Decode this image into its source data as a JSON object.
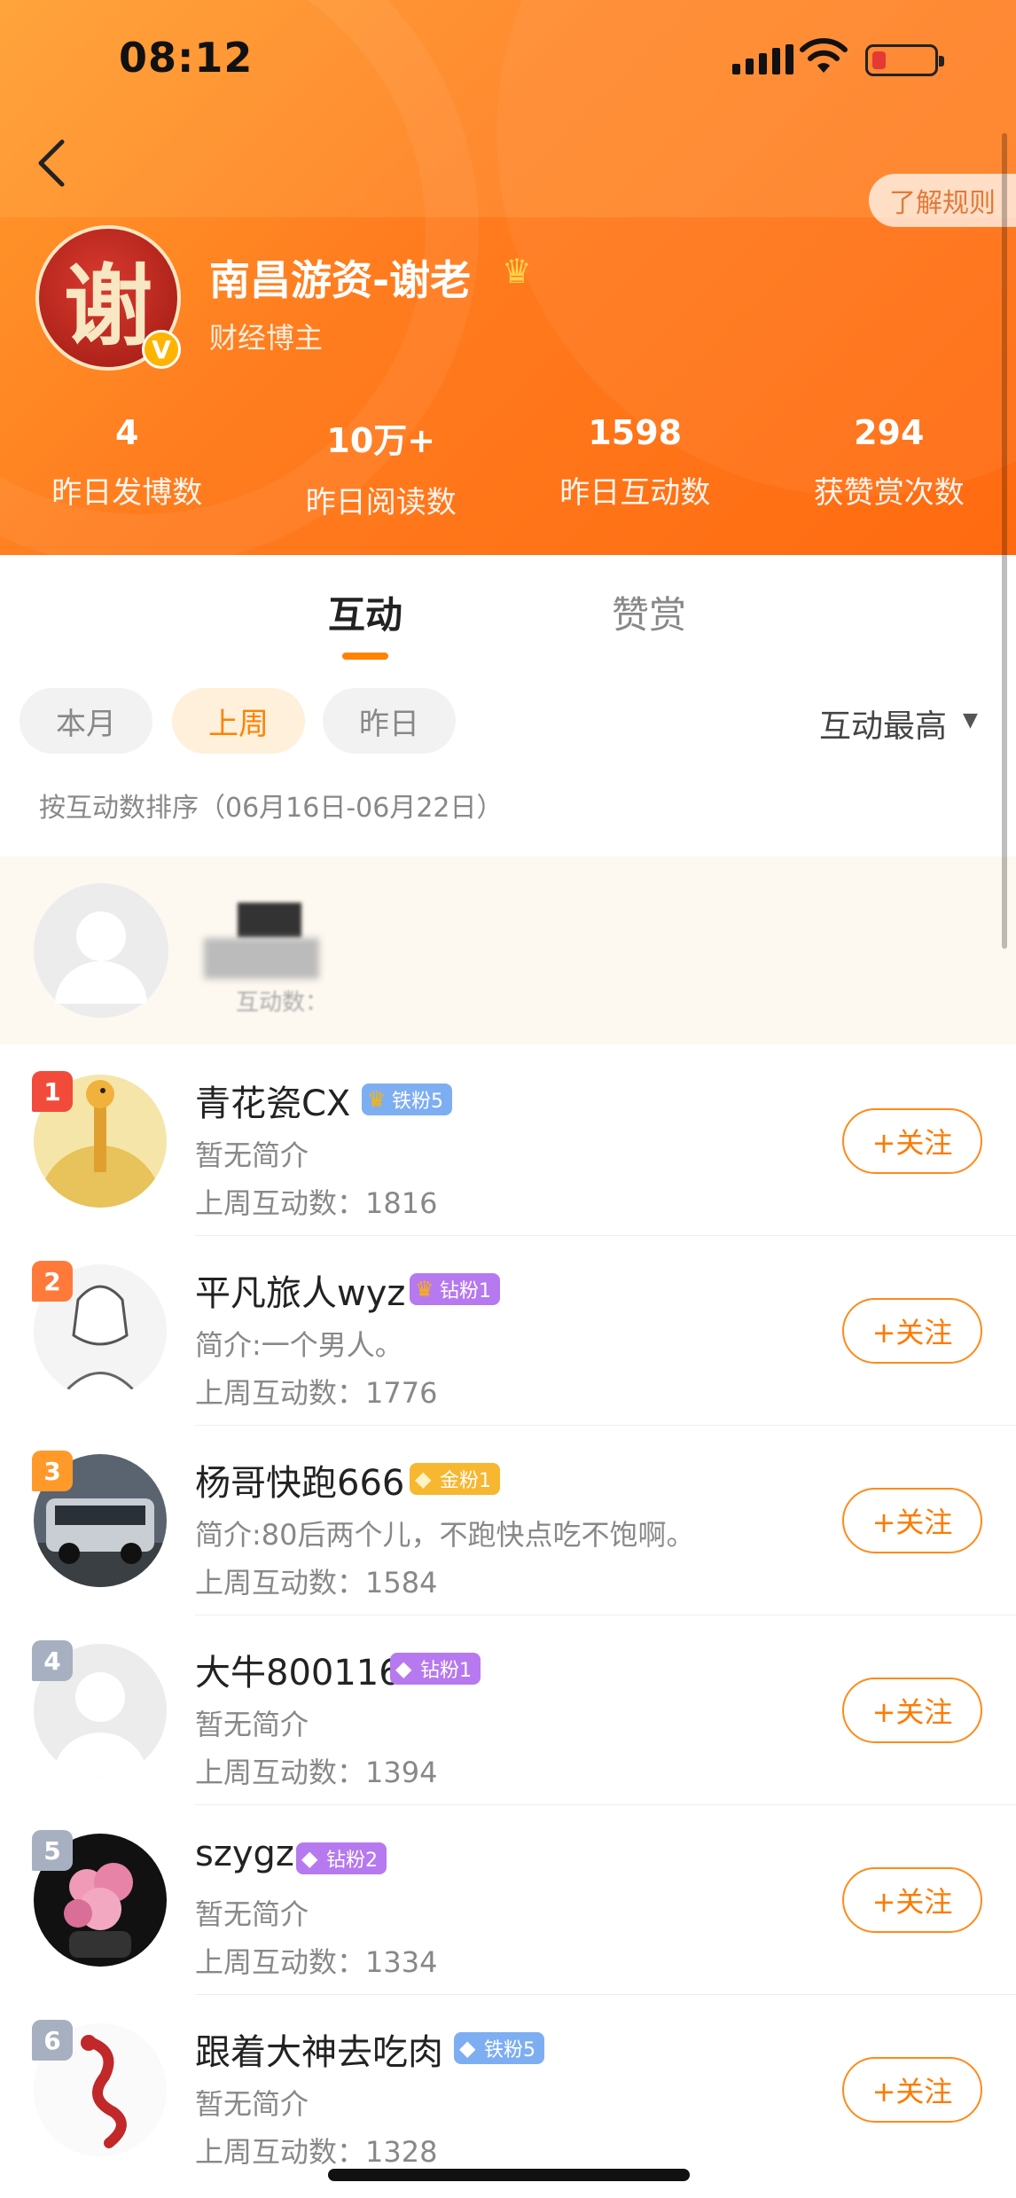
{
  "status_bar": {
    "time": "08:12"
  },
  "header": {
    "rules_label": "了解规则",
    "avatar_char": "谢",
    "verified_mark": "V",
    "profile_name": "南昌游资-谢老",
    "profile_role": "财经博主",
    "stats": [
      {
        "value": "4",
        "label": "昨日发博数"
      },
      {
        "value": "10万+",
        "label": "昨日阅读数"
      },
      {
        "value": "1598",
        "label": "昨日互动数"
      },
      {
        "value": "294",
        "label": "获赞赏次数"
      }
    ]
  },
  "tabs": {
    "active": "互动",
    "inactive": "赞赏"
  },
  "filters": {
    "pills": [
      "本月",
      "上周",
      "昨日"
    ],
    "selected": "上周",
    "sort_label": "互动最高"
  },
  "sort_note": "按互动数排序（06月16日-06月22日）",
  "my_row": {
    "count_label": "互动数："
  },
  "list": [
    {
      "rank": "1",
      "name": "青花瓷CX",
      "badge": "铁粉5",
      "bio": "暂无简介",
      "count": "上周互动数：1816",
      "follow": "+关注"
    },
    {
      "rank": "2",
      "name": "平凡旅人wyz",
      "badge": "钻粉1",
      "bio": "简介:一个男人。",
      "count": "上周互动数：1776",
      "follow": "+关注"
    },
    {
      "rank": "3",
      "name": "杨哥快跑666",
      "badge": "金粉1",
      "bio": "简介:80后两个儿，不跑快点吃不饱啊。",
      "count": "上周互动数：1584",
      "follow": "+关注"
    },
    {
      "rank": "4",
      "name": "大牛800116",
      "badge": "钻粉1",
      "bio": "暂无简介",
      "count": "上周互动数：1394",
      "follow": "+关注"
    },
    {
      "rank": "5",
      "name": "szygz",
      "badge": "钻粉2",
      "bio": "暂无简介",
      "count": "上周互动数：1334",
      "follow": "+关注"
    },
    {
      "rank": "6",
      "name": "跟着大神去吃肉",
      "badge": "铁粉5",
      "bio": "暂无简介",
      "count": "上周互动数：1328",
      "follow": "+关注"
    }
  ],
  "colors": {
    "brand": "#ff8200",
    "rank1": "#f24b3c",
    "rank2": "#ff7a3a",
    "rank3": "#ff9a2a",
    "rank_other": "#a7b0c0"
  }
}
